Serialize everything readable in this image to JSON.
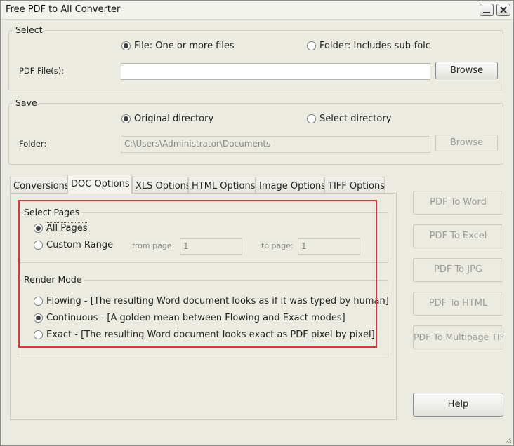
{
  "window": {
    "title": "Free PDF to All Converter"
  },
  "select": {
    "legend": "Select",
    "file_option": "File:  One or more files",
    "folder_option": "Folder: Includes sub-folc",
    "pdf_files_label": "PDF File(s):",
    "pdf_files_value": "",
    "browse_label": "Browse"
  },
  "save": {
    "legend": "Save",
    "original_option": "Original directory",
    "select_option": "Select directory",
    "folder_label": "Folder:",
    "folder_value": "C:\\Users\\Administrator\\Documents",
    "browse_label": "Browse"
  },
  "tabs": [
    "Conversions",
    "DOC Options",
    "XLS Options",
    "HTML Options",
    "Image Options",
    "TIFF Options"
  ],
  "active_tab": "DOC Options",
  "doc_options": {
    "select_pages": {
      "legend": "Select Pages",
      "all_pages": "All Pages",
      "custom_range": "Custom Range",
      "from_label": "from page:",
      "from_value": "1",
      "to_label": "to page:",
      "to_value": "1"
    },
    "render_mode": {
      "legend": "Render Mode",
      "flowing": "Flowing - [The resulting Word document looks as if it was typed by human]",
      "continuous": "Continuous - [A golden mean between Flowing and Exact modes]",
      "exact": "Exact - [The resulting Word document looks exact as PDF pixel by pixel]"
    }
  },
  "actions": {
    "to_word": "PDF To Word",
    "to_excel": "PDF To Excel",
    "to_jpg": "PDF To JPG",
    "to_html": "PDF To HTML",
    "to_tiff": "PDF To Multipage TIFF",
    "help": "Help"
  },
  "colors": {
    "highlight": "#d93636",
    "background": "#ecebe2"
  }
}
